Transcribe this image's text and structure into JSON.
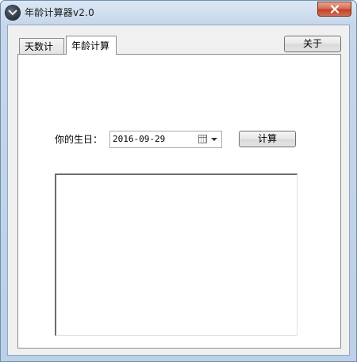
{
  "window": {
    "title": "年龄计算器v2.0",
    "close_icon": "close-icon",
    "app_icon": "app-icon"
  },
  "tabs": [
    {
      "label": "天数计算",
      "selected": false
    },
    {
      "label": "年龄计算",
      "selected": true
    }
  ],
  "about_button": {
    "label": "关于"
  },
  "form": {
    "birthday_label": "你的生日：",
    "birthday_value": "2016-09-29",
    "calendar_icon": "calendar-icon",
    "calc_button": "计算"
  },
  "result": {
    "text": ""
  },
  "colors": {
    "close_red": "#c24125",
    "frame_blue": "#bcd0e6",
    "panel_bg": "#ffffff",
    "client_bg": "#f0f0f0"
  }
}
